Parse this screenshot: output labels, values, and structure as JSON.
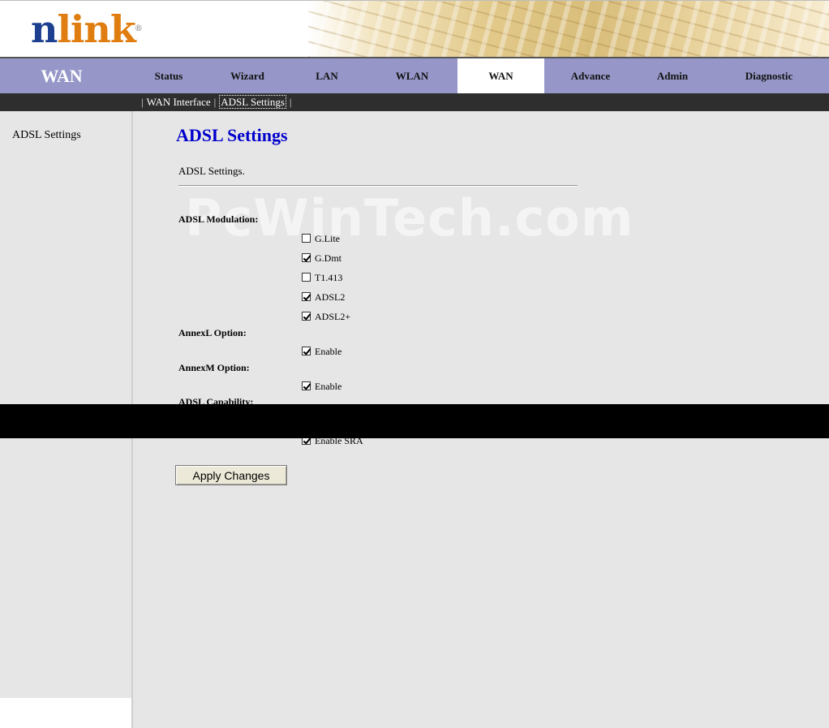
{
  "logo": {
    "text_n": "n",
    "text_rest": "link",
    "registered": "®"
  },
  "nav": {
    "section": "WAN",
    "tabs": [
      {
        "label": "Status",
        "active": false
      },
      {
        "label": "Wizard",
        "active": false
      },
      {
        "label": "LAN",
        "active": false
      },
      {
        "label": "WLAN",
        "active": false
      },
      {
        "label": "WAN",
        "active": true
      },
      {
        "label": "Advance",
        "active": false
      },
      {
        "label": "Admin",
        "active": false
      },
      {
        "label": "Diagnostic",
        "active": false
      }
    ]
  },
  "subnav": {
    "separator": "|",
    "links": [
      {
        "label": "WAN Interface",
        "active": false
      },
      {
        "label": "ADSL Settings",
        "active": true
      }
    ]
  },
  "sidebar": {
    "items": [
      {
        "label": "ADSL Settings"
      }
    ]
  },
  "main": {
    "title": "ADSL Settings",
    "description": "ADSL Settings.",
    "watermark": "PcWinTech.com",
    "modulation_label": "ADSL Modulation:",
    "modulation_options": [
      {
        "label": "G.Lite",
        "checked": false
      },
      {
        "label": "G.Dmt",
        "checked": true
      },
      {
        "label": "T1.413",
        "checked": false
      },
      {
        "label": "ADSL2",
        "checked": true
      },
      {
        "label": "ADSL2+",
        "checked": true
      }
    ],
    "annexl_label": "AnnexL Option:",
    "annexl_enable": {
      "label": "Enable",
      "checked": true
    },
    "annexm_label": "AnnexM Option:",
    "annexm_enable": {
      "label": "Enable",
      "checked": true
    },
    "capability_label": "ADSL Capability:",
    "sra": {
      "label": "Enable SRA",
      "checked": true
    },
    "apply_button": "Apply Changes"
  },
  "colors": {
    "nav_bg": "#9697c8",
    "subnav_bg": "#2e2e2e",
    "title": "#0000cc",
    "logo_blue": "#1d3f8f",
    "logo_orange": "#e07d10",
    "page_bg": "#e6e6e6"
  }
}
